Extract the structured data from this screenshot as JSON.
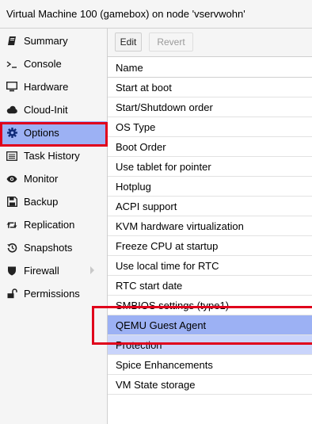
{
  "window": {
    "title": "Virtual Machine 100 (gamebox) on node 'vservwohn'"
  },
  "sidebar": {
    "items": [
      {
        "label": "Summary",
        "icon": "book-icon"
      },
      {
        "label": "Console",
        "icon": "terminal-icon"
      },
      {
        "label": "Hardware",
        "icon": "monitor-icon"
      },
      {
        "label": "Cloud-Init",
        "icon": "cloud-icon"
      },
      {
        "label": "Options",
        "icon": "gear-icon"
      },
      {
        "label": "Task History",
        "icon": "list-icon"
      },
      {
        "label": "Monitor",
        "icon": "eye-icon"
      },
      {
        "label": "Backup",
        "icon": "floppy-icon"
      },
      {
        "label": "Replication",
        "icon": "retweet-icon"
      },
      {
        "label": "Snapshots",
        "icon": "history-icon"
      },
      {
        "label": "Firewall",
        "icon": "shield-icon"
      },
      {
        "label": "Permissions",
        "icon": "unlock-icon"
      }
    ],
    "selected": "Options"
  },
  "toolbar": {
    "edit_label": "Edit",
    "revert_label": "Revert"
  },
  "options": {
    "header": "Name",
    "rows": [
      "Start at boot",
      "Start/Shutdown order",
      "OS Type",
      "Boot Order",
      "Use tablet for pointer",
      "Hotplug",
      "ACPI support",
      "KVM hardware virtualization",
      "Freeze CPU at startup",
      "Use local time for RTC",
      "RTC start date",
      "SMBIOS settings (type1)",
      "QEMU Guest Agent",
      "Protection",
      "Spice Enhancements",
      "VM State storage"
    ],
    "selected": "QEMU Guest Agent"
  },
  "colors": {
    "selection": "#9cb1f4",
    "highlight_box": "#e0001b"
  }
}
